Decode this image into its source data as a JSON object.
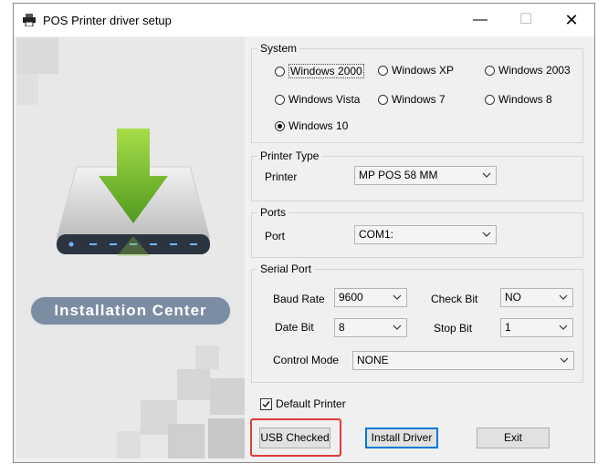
{
  "window": {
    "title": "POS Printer driver setup"
  },
  "left_panel": {
    "badge": "Installation Center"
  },
  "system": {
    "label": "System",
    "options": [
      "Windows 2000",
      "Windows XP",
      "Windows 2003",
      "Windows Vista",
      "Windows 7",
      "Windows 8",
      "Windows 10"
    ],
    "selected": "Windows 10"
  },
  "printer_type": {
    "label": "Printer Type",
    "printer_label": "Printer",
    "printer_value": "MP POS 58 MM"
  },
  "ports": {
    "label": "Ports",
    "port_label": "Port",
    "port_value": "COM1:"
  },
  "serial_port": {
    "label": "Serial Port",
    "baud_rate_label": "Baud Rate",
    "baud_rate_value": "9600",
    "check_bit_label": "Check Bit",
    "check_bit_value": "NO",
    "date_bit_label": "Date Bit",
    "date_bit_value": "8",
    "stop_bit_label": "Stop Bit",
    "stop_bit_value": "1",
    "control_mode_label": "Control Mode",
    "control_mode_value": "NONE"
  },
  "default_printer": {
    "label": "Default Printer",
    "checked": true
  },
  "buttons": {
    "usb_checked": "USB Checked",
    "install_driver": "Install Driver",
    "exit": "Exit"
  },
  "colors": {
    "highlight": "#e03b3b",
    "badge": "#7c8ca2",
    "arrow": "#7cbf2e",
    "focus": "#0078d7"
  }
}
